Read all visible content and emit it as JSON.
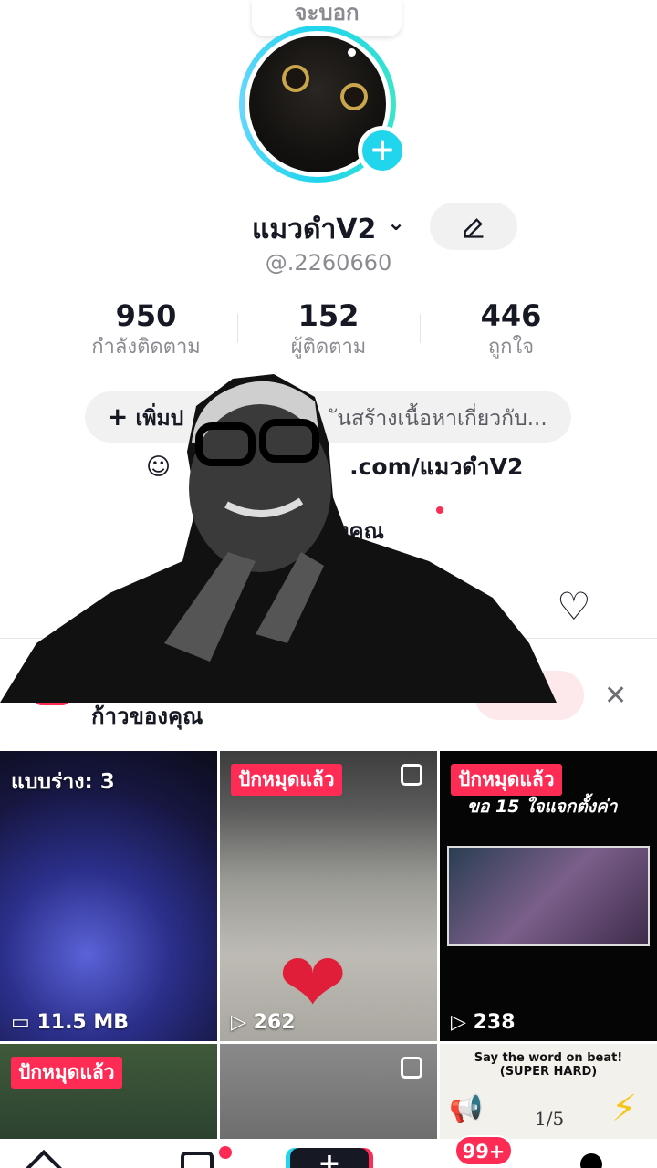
{
  "tooltip": {
    "text": "จะบอก"
  },
  "profile": {
    "display_name": "แมวดำV2",
    "handle": "@.2260660",
    "edit_icon": "pencil-icon",
    "avatar_add_icon": "plus-icon"
  },
  "stats": [
    {
      "value": "950",
      "label": "กำลังติดตาม"
    },
    {
      "value": "152",
      "label": "ผู้ติดตาม"
    },
    {
      "value": "446",
      "label": "ถูกใจ"
    }
  ],
  "bio_button": {
    "prefix": "เพิ่มป",
    "rest": "ันสร้างเนื้อหาเกี่ยวกับ..."
  },
  "link": {
    "text": ".com/แมวดำV2"
  },
  "promo": {
    "text": "ของคุณ"
  },
  "banner": {
    "text": "ก้าวของคุณ"
  },
  "grid": {
    "cells": [
      {
        "badge": "แบบร่าง: 3",
        "footer": "11.5 MB"
      },
      {
        "badge": "ปักหมุดแล้ว",
        "footer": "262"
      },
      {
        "badge": "ปักหมุดแล้ว",
        "caption": "ขอ 15 ใจแจกตั้งค่า",
        "footer": "238"
      },
      {
        "badge": "ปักหมุดแล้ว"
      },
      {},
      {
        "caption": "Say the word on beat!\n(SUPER HARD)",
        "pages": "1/5"
      }
    ]
  },
  "bottom_nav": {
    "inbox_badge": "99+"
  },
  "colors": {
    "accent_pink": "#fe2c55",
    "accent_cyan": "#20d5ec"
  }
}
